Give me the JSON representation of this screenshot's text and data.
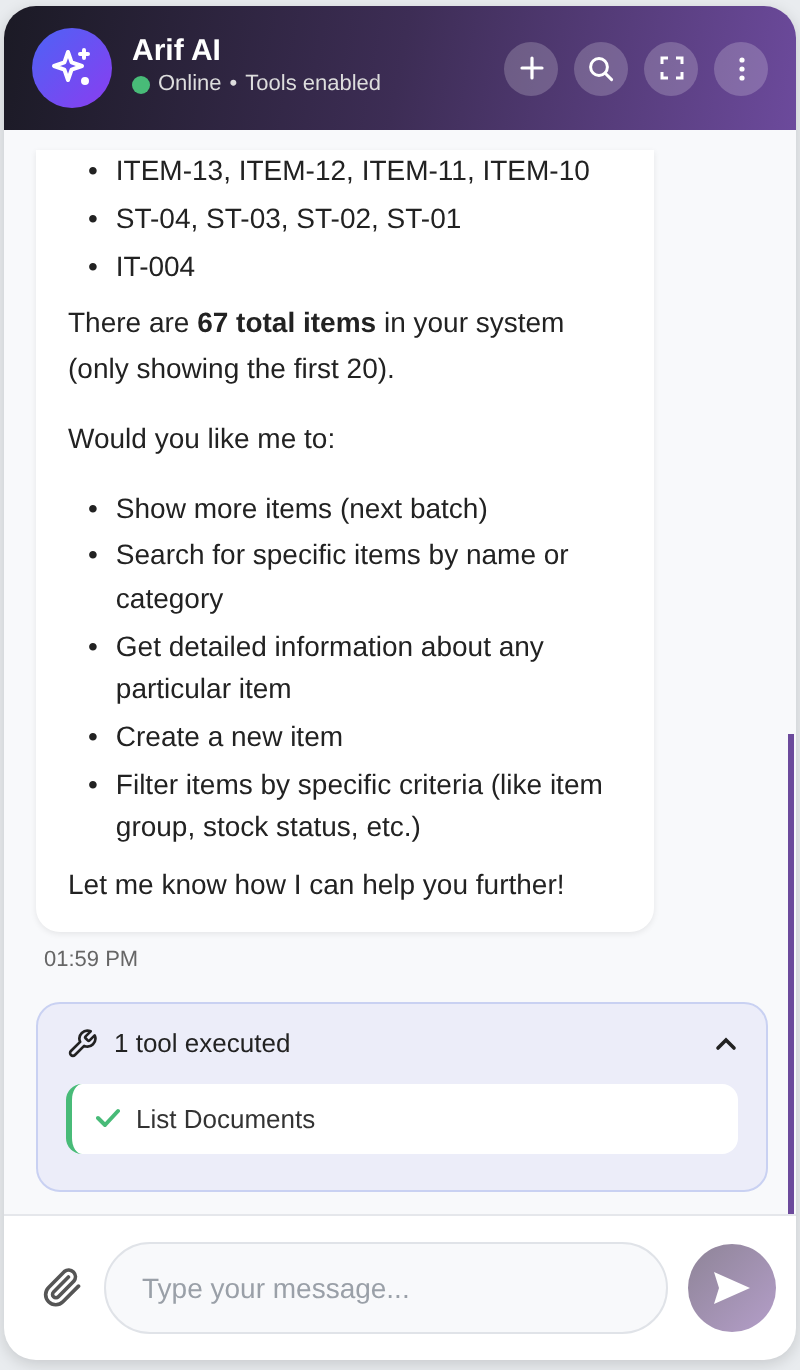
{
  "header": {
    "title": "Arif AI",
    "status": "Online",
    "status_online": true,
    "separator": "•",
    "subtitle": "Tools enabled"
  },
  "message": {
    "blocks": [
      {
        "kind": "list",
        "marker": "•",
        "items": [
          "ITEM-13, ITEM-12, ITEM-11, ITEM-10",
          "ST-04, ST-03, ST-02, ST-01",
          "IT-004"
        ]
      },
      {
        "kind": "para",
        "text": "There are **67 total items** in your system (only showing the first 20)."
      },
      {
        "kind": "para",
        "text": "Would you like me to:"
      },
      {
        "kind": "list",
        "marker": "•",
        "items": [
          "Show more items (next batch)",
          "Search for specific items by name or category",
          "Get detailed information about any particular item",
          "Create a new item",
          "Filter items by specific criteria (like item group, stock status, etc.)"
        ]
      },
      {
        "kind": "para",
        "text": "Let me know how I can help you further!"
      }
    ],
    "time": "01:59 PM"
  },
  "tools": {
    "summary": "1 tool executed",
    "expanded": true,
    "items": [
      {
        "name": "List Documents",
        "done": true
      }
    ]
  },
  "composer": {
    "placeholder": "Type your message..."
  }
}
